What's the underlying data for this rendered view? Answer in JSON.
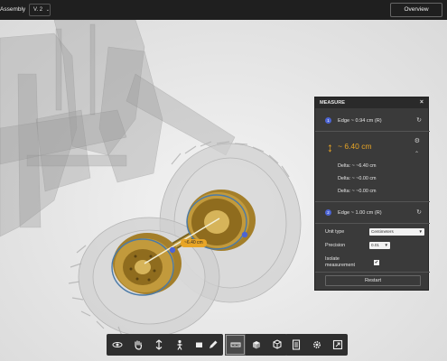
{
  "topbar": {
    "title": "Assembly",
    "version": "V. 2",
    "version_caret": "⌄",
    "overview_label": "Overview"
  },
  "viewport": {
    "measure_tag": "~6.40 cm"
  },
  "measure_panel": {
    "title": "MEASURE",
    "close": "×",
    "edge1": {
      "badge": "1",
      "label": "Edge ~ 0.94 cm (R)"
    },
    "distance": "~ 6.40 cm",
    "deltas": [
      "Delta: ~ ~6.40 cm",
      "Delta: ~ ~0.00 cm",
      "Delta: ~ ~0.00 cm"
    ],
    "edge2": {
      "badge": "2",
      "label": "Edge ~ 1.00 cm (R)"
    },
    "unit_type_label": "Unit type",
    "unit_type_value": "Centimeters",
    "precision_label": "Precision",
    "precision_value": "0.01",
    "isolate_label_1": "Isolate",
    "isolate_label_2": "measurement",
    "isolate_checked": "✔",
    "restart_label": "Restart"
  },
  "toolbar": {
    "groups": [
      [
        "orbit-icon",
        "pan-icon",
        "fit-icon",
        "first-person-icon",
        "camera-icon"
      ],
      [
        "markup-icon"
      ],
      [
        "measure-icon",
        "section-icon",
        "explode-icon"
      ],
      [
        "model-browser-icon",
        "settings-icon",
        "fullscreen-icon"
      ]
    ]
  },
  "colors": {
    "accent_orange": "#e8a526",
    "edge_badge_blue": "#4c64d4",
    "panel_bg": "#3a3a3a",
    "topbar_bg": "#1f1f1f"
  }
}
